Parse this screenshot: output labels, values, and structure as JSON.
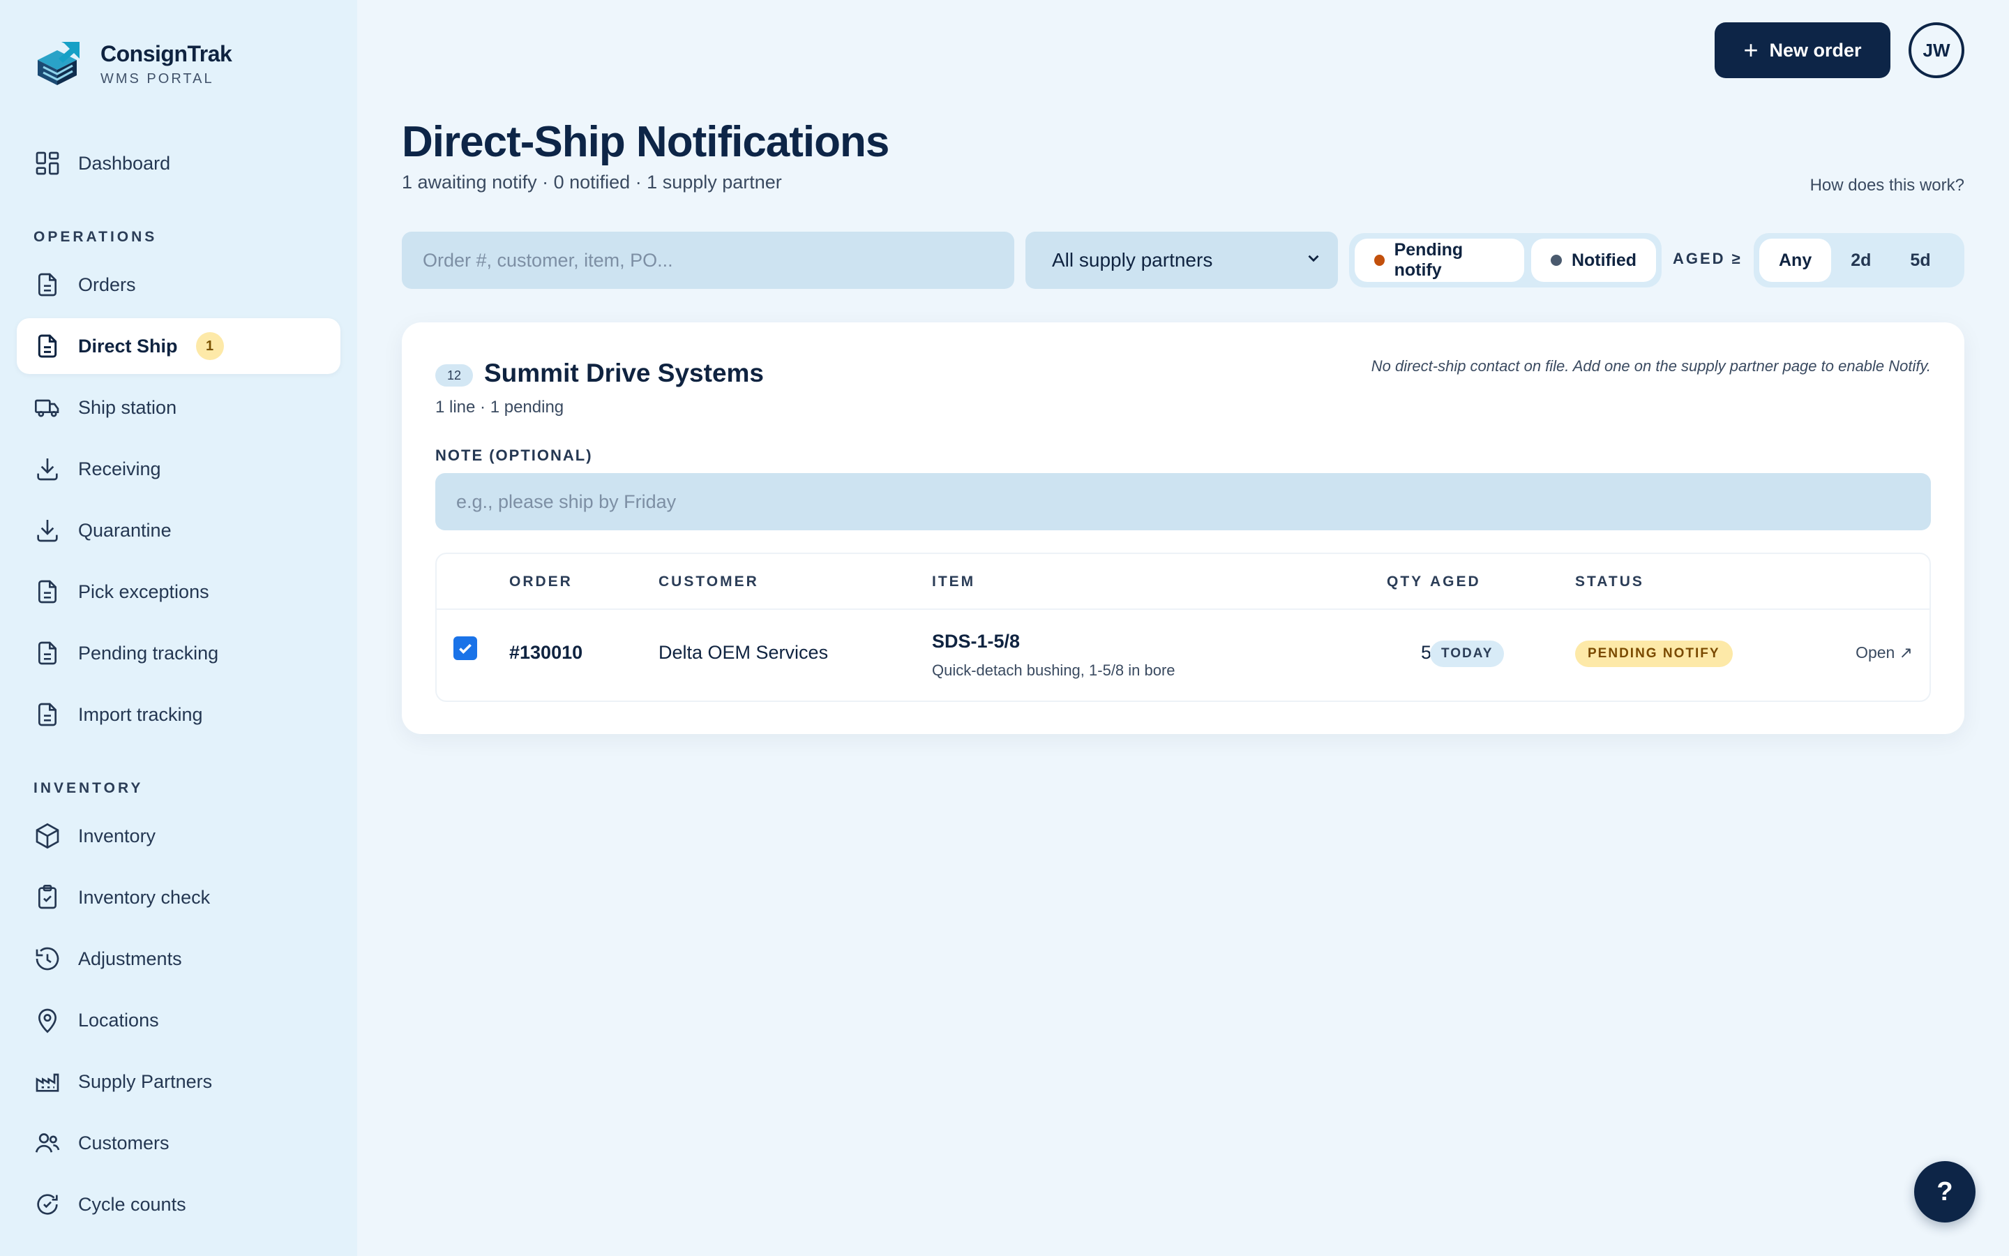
{
  "app": {
    "name": "ConsignTrak",
    "subtitle": "WMS PORTAL"
  },
  "sidebar": {
    "top_items": [
      {
        "label": "Dashboard",
        "icon": "grid-icon"
      }
    ],
    "operations_label": "OPERATIONS",
    "operations": [
      {
        "label": "Orders",
        "icon": "document-icon"
      },
      {
        "label": "Direct Ship",
        "icon": "document-icon",
        "badge": "1",
        "active": true
      },
      {
        "label": "Ship station",
        "icon": "truck-icon"
      },
      {
        "label": "Receiving",
        "icon": "download-icon"
      },
      {
        "label": "Quarantine",
        "icon": "download-icon"
      },
      {
        "label": "Pick exceptions",
        "icon": "document-icon"
      },
      {
        "label": "Pending tracking",
        "icon": "document-icon"
      },
      {
        "label": "Import tracking",
        "icon": "document-icon"
      }
    ],
    "inventory_label": "INVENTORY",
    "inventory": [
      {
        "label": "Inventory",
        "icon": "box-icon"
      },
      {
        "label": "Inventory check",
        "icon": "clipboard-check-icon"
      },
      {
        "label": "Adjustments",
        "icon": "history-icon"
      },
      {
        "label": "Locations",
        "icon": "map-pin-icon"
      },
      {
        "label": "Supply Partners",
        "icon": "factory-icon"
      },
      {
        "label": "Customers",
        "icon": "users-icon"
      },
      {
        "label": "Cycle counts",
        "icon": "refresh-check-icon"
      }
    ]
  },
  "header": {
    "new_order_label": "New order",
    "avatar_initials": "JW"
  },
  "page": {
    "title": "Direct-Ship Notifications",
    "subtitle": "1 awaiting notify · 0 notified · 1 supply partner",
    "help_link": "How does this work?"
  },
  "filters": {
    "search_placeholder": "Order #, customer, item, PO...",
    "partner_select": "All supply partners",
    "status_pills": [
      {
        "label": "Pending notify",
        "dot_color": "#c2500c"
      },
      {
        "label": "Notified",
        "dot_color": "#4a5a6e"
      }
    ],
    "aged_label": "AGED ≥",
    "aged_options": [
      {
        "label": "Any",
        "selected": true
      },
      {
        "label": "2d",
        "selected": false
      },
      {
        "label": "5d",
        "selected": false
      }
    ]
  },
  "group": {
    "count": "12",
    "name": "Summit Drive Systems",
    "meta": "1 line · 1 pending",
    "warning": "No direct-ship contact on file. Add one on the supply partner page to enable Notify.",
    "note_label": "NOTE (OPTIONAL)",
    "note_placeholder": "e.g., please ship by Friday",
    "columns": {
      "order": "ORDER",
      "customer": "CUSTOMER",
      "item": "ITEM",
      "qty": "QTY",
      "aged": "AGED",
      "status": "STATUS"
    },
    "rows": [
      {
        "checked": true,
        "order": "#130010",
        "customer": "Delta OEM Services",
        "item_code": "SDS-1-5/8",
        "item_desc": "Quick-detach bushing, 1-5/8 in bore",
        "qty": "5",
        "aged": "TODAY",
        "status": "PENDING NOTIFY",
        "action": "Open ↗"
      }
    ]
  },
  "help_fab": "?",
  "colors": {
    "accent": "#0d2547",
    "pending": "#c2500c",
    "checkbox": "#1a73e8"
  }
}
